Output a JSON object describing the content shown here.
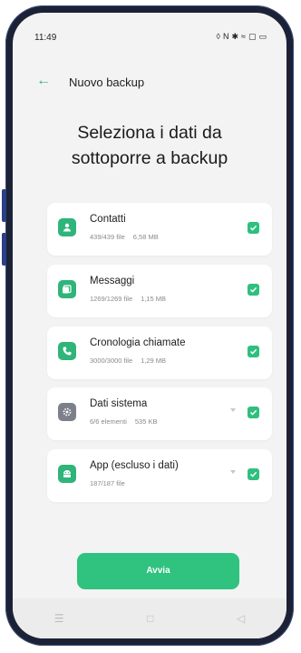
{
  "status_bar": {
    "time": "11:49",
    "icons": [
      "location-icon",
      "nfc-icon",
      "bluetooth-icon",
      "wifi-icon",
      "sim-icon",
      "battery-icon"
    ]
  },
  "header": {
    "back_icon": "arrow-left-icon",
    "title": "Nuovo backup"
  },
  "page": {
    "title_line1": "Seleziona i dati da",
    "title_line2": "sottoporre a backup"
  },
  "items": [
    {
      "name": "Contatti",
      "count": "439/439 file",
      "size": "6,58 MB",
      "icon": "contact-icon",
      "icon_color": "#2fb57a",
      "checked": true,
      "expandable": false
    },
    {
      "name": "Messaggi",
      "count": "1269/1269 file",
      "size": "1,15 MB",
      "icon": "message-icon",
      "icon_color": "#2fb57a",
      "checked": true,
      "expandable": false
    },
    {
      "name": "Cronologia chiamate",
      "count": "3000/3000 file",
      "size": "1,29 MB",
      "icon": "phone-icon",
      "icon_color": "#2fb57a",
      "checked": true,
      "expandable": false
    },
    {
      "name": "Dati sistema",
      "count": "6/6 elementi",
      "size": "535 KB",
      "icon": "settings-icon",
      "icon_color": "#7c8089",
      "checked": true,
      "expandable": true
    },
    {
      "name": "App (escluso i dati)",
      "count": "187/187 file",
      "size": "",
      "icon": "android-app-icon",
      "icon_color": "#2fb57a",
      "checked": true,
      "expandable": true
    }
  ],
  "actions": {
    "start_label": "Avvia"
  },
  "colors": {
    "accent": "#30c27f",
    "card_background": "#ffffff",
    "screen_background": "#f3f3f3"
  }
}
